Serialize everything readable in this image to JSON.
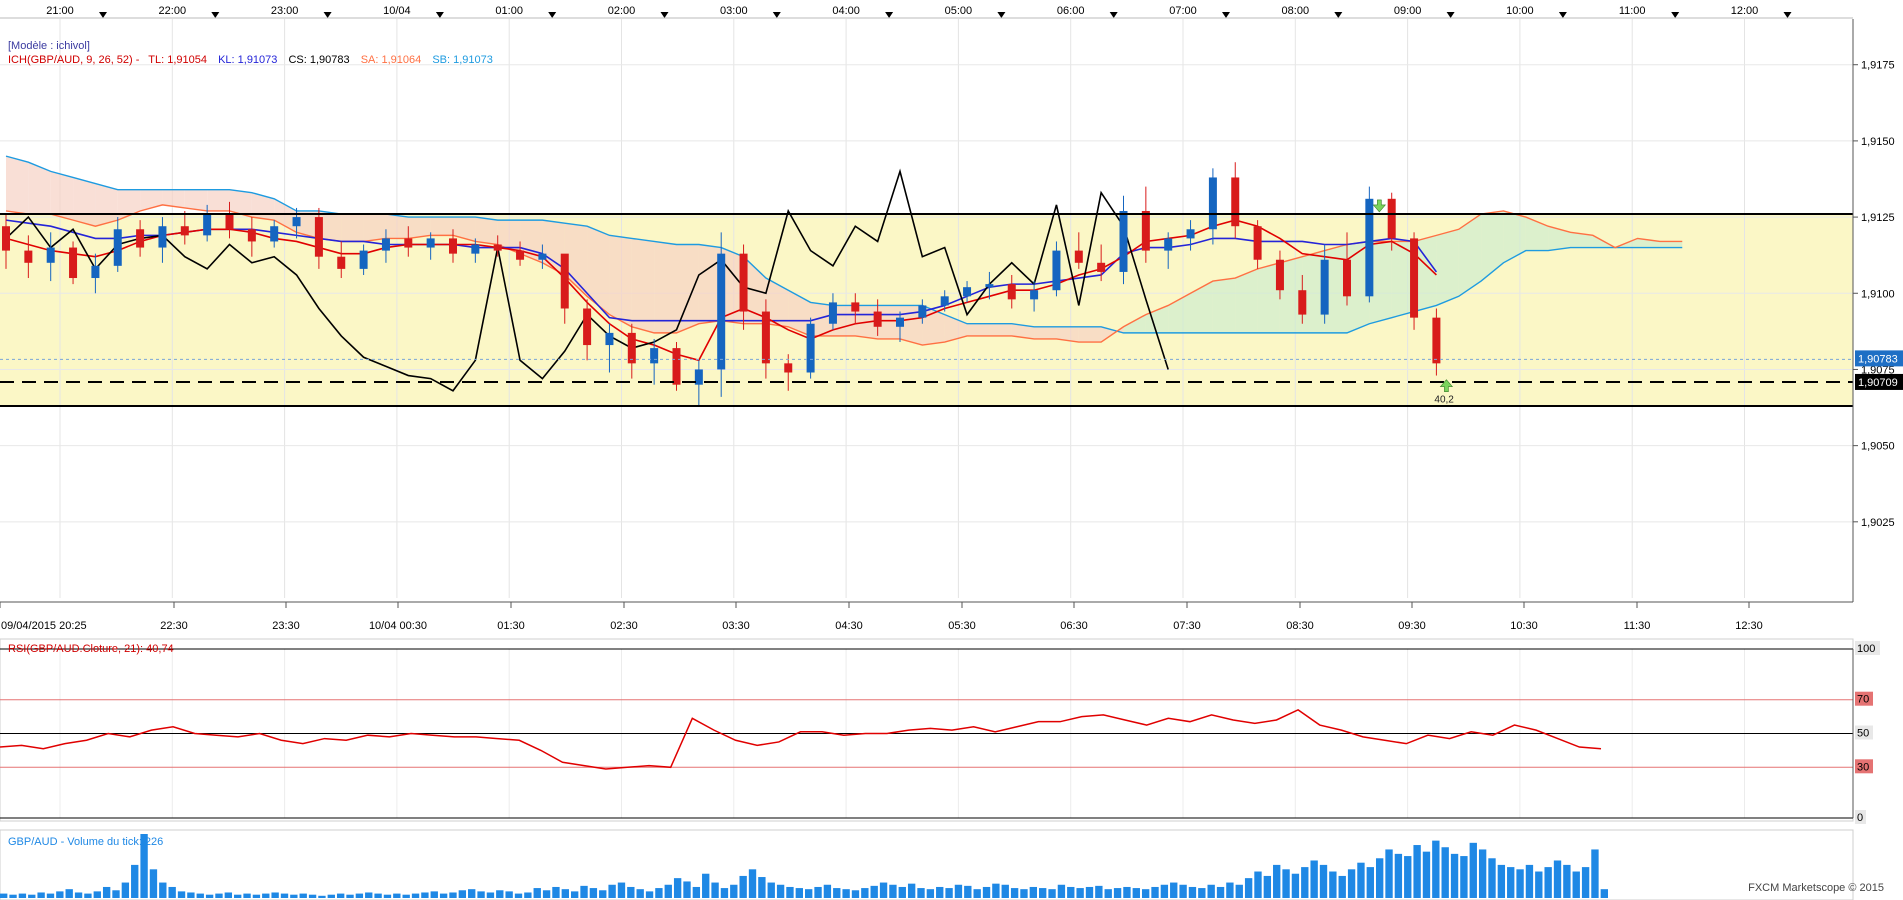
{
  "colors": {
    "bullish": "#1565c0",
    "bearish": "#d81b1b",
    "tenkan": "#e00000",
    "kijun": "#2424d8",
    "chikou": "#000000",
    "senkou_a": "#ff7043",
    "senkou_b": "#1e9be0",
    "band": "#fbf7c6",
    "rsi": "#e00000",
    "volume": "#1e88e5"
  },
  "top_time_axis": [
    "21:00",
    "22:00",
    "23:00",
    "10/04",
    "01:00",
    "02:00",
    "03:00",
    "04:00",
    "05:00",
    "06:00",
    "07:00",
    "08:00",
    "09:00",
    "10:00",
    "11:00",
    "12:00"
  ],
  "bottom_time_axis": [
    "09/04/2015 20:25",
    "22:30",
    "23:30",
    "10/04 00:30",
    "01:30",
    "02:30",
    "03:30",
    "04:30",
    "05:30",
    "06:30",
    "07:30",
    "08:30",
    "09:30",
    "10:30",
    "11:30",
    "12:30"
  ],
  "price_axis": [
    "1,9175",
    "1,9150",
    "1,9125",
    "1,9100",
    "1,9075",
    "1,9050",
    "1,9025"
  ],
  "price_badges": {
    "last": "1,90783",
    "marker": "1,90709"
  },
  "legend": {
    "model": "[Modèle : ichivol]",
    "ich": "ICH(GBP/AUD, 9, 26, 52) -",
    "tl": "TL: 1,91054",
    "kl": "KL: 1,91073",
    "cs": "CS: 1,90783",
    "sa": "SA: 1,91064",
    "sb": "SB: 1,91073"
  },
  "annotation": "40,2",
  "rsi": {
    "title": "RSI(GBP/AUD.Cloture, 21): 40,74",
    "levels": [
      "100",
      "70",
      "50",
      "30",
      "0"
    ]
  },
  "volume_panel": {
    "title": "GBP/AUD - Volume du tick: 226"
  },
  "watermark": "FXCM Marketscope © 2015",
  "chart_data": [
    {
      "type": "candlestick",
      "title": "ICH(GBP/AUD, 9, 26, 52)",
      "ylim": [
        1.9,
        1.919
      ],
      "zones": {
        "upper": 1.9126,
        "lower": 1.9063,
        "dashed": 1.90709
      },
      "candles": [
        [
          1.9122,
          1.9126,
          1.9108,
          1.9114
        ],
        [
          1.9114,
          1.9119,
          1.9105,
          1.911
        ],
        [
          1.911,
          1.912,
          1.9104,
          1.9115
        ],
        [
          1.9115,
          1.9117,
          1.9103,
          1.9105
        ],
        [
          1.9105,
          1.9113,
          1.91,
          1.9109
        ],
        [
          1.9109,
          1.9125,
          1.9107,
          1.9121
        ],
        [
          1.9121,
          1.9124,
          1.9112,
          1.9115
        ],
        [
          1.9115,
          1.9125,
          1.911,
          1.9122
        ],
        [
          1.9122,
          1.9127,
          1.9116,
          1.9119
        ],
        [
          1.9119,
          1.9129,
          1.9117,
          1.9126
        ],
        [
          1.9126,
          1.913,
          1.9118,
          1.9121
        ],
        [
          1.9121,
          1.9125,
          1.9112,
          1.9117
        ],
        [
          1.9117,
          1.9124,
          1.9115,
          1.9122
        ],
        [
          1.9122,
          1.9128,
          1.9118,
          1.9125
        ],
        [
          1.9125,
          1.9128,
          1.9108,
          1.9112
        ],
        [
          1.9112,
          1.9117,
          1.9105,
          1.9108
        ],
        [
          1.9108,
          1.9116,
          1.9106,
          1.9114
        ],
        [
          1.9114,
          1.9121,
          1.911,
          1.9118
        ],
        [
          1.9118,
          1.9122,
          1.9112,
          1.9115
        ],
        [
          1.9115,
          1.912,
          1.9111,
          1.9118
        ],
        [
          1.9118,
          1.9121,
          1.911,
          1.9113
        ],
        [
          1.9113,
          1.9118,
          1.911,
          1.9116
        ],
        [
          1.9116,
          1.9119,
          1.9112,
          1.9114
        ],
        [
          1.9114,
          1.9117,
          1.9109,
          1.9111
        ],
        [
          1.9111,
          1.9116,
          1.9108,
          1.9113
        ],
        [
          1.9113,
          1.911,
          1.909,
          1.9095
        ],
        [
          1.9095,
          1.9098,
          1.9078,
          1.9083
        ],
        [
          1.9083,
          1.909,
          1.9074,
          1.9087
        ],
        [
          1.9087,
          1.909,
          1.9072,
          1.9077
        ],
        [
          1.9077,
          1.9085,
          1.907,
          1.9082
        ],
        [
          1.9082,
          1.9084,
          1.9068,
          1.907
        ],
        [
          1.907,
          1.9078,
          1.9063,
          1.9075
        ],
        [
          1.9075,
          1.912,
          1.9066,
          1.9113
        ],
        [
          1.9113,
          1.9116,
          1.9088,
          1.9094
        ],
        [
          1.9094,
          1.9098,
          1.9072,
          1.9077
        ],
        [
          1.9077,
          1.908,
          1.9068,
          1.9074
        ],
        [
          1.9074,
          1.9092,
          1.9072,
          1.909
        ],
        [
          1.909,
          1.91,
          1.9088,
          1.9097
        ],
        [
          1.9097,
          1.91,
          1.909,
          1.9094
        ],
        [
          1.9094,
          1.9098,
          1.9086,
          1.9089
        ],
        [
          1.9089,
          1.9094,
          1.9084,
          1.9092
        ],
        [
          1.9092,
          1.9098,
          1.909,
          1.9096
        ],
        [
          1.9096,
          1.9101,
          1.9094,
          1.9099
        ],
        [
          1.9099,
          1.9104,
          1.9097,
          1.9102
        ],
        [
          1.9102,
          1.9107,
          1.9098,
          1.9103
        ],
        [
          1.9103,
          1.9106,
          1.9095,
          1.9098
        ],
        [
          1.9098,
          1.9104,
          1.9094,
          1.9101
        ],
        [
          1.9101,
          1.9117,
          1.9099,
          1.9114
        ],
        [
          1.9114,
          1.912,
          1.9108,
          1.911
        ],
        [
          1.911,
          1.9116,
          1.9104,
          1.9107
        ],
        [
          1.9107,
          1.9132,
          1.9103,
          1.9127
        ],
        [
          1.9127,
          1.9135,
          1.911,
          1.9114
        ],
        [
          1.9114,
          1.912,
          1.9108,
          1.9118
        ],
        [
          1.9118,
          1.9124,
          1.9114,
          1.9121
        ],
        [
          1.9121,
          1.9141,
          1.9116,
          1.9138
        ],
        [
          1.9138,
          1.9143,
          1.9118,
          1.9122
        ],
        [
          1.9122,
          1.9124,
          1.9108,
          1.9111
        ],
        [
          1.9111,
          1.9114,
          1.9098,
          1.9101
        ],
        [
          1.9101,
          1.9106,
          1.909,
          1.9093
        ],
        [
          1.9093,
          1.9116,
          1.909,
          1.9111
        ],
        [
          1.9111,
          1.912,
          1.9096,
          1.9099
        ],
        [
          1.9099,
          1.9135,
          1.9097,
          1.9131
        ],
        [
          1.9131,
          1.9133,
          1.9114,
          1.9118
        ],
        [
          1.9118,
          1.912,
          1.9088,
          1.9092
        ],
        [
          1.9092,
          1.9095,
          1.9073,
          1.9077
        ]
      ],
      "tenkan": [
        1.9118,
        1.9116,
        1.9114,
        1.9113,
        1.9112,
        1.9114,
        1.9117,
        1.9119,
        1.912,
        1.9121,
        1.9121,
        1.912,
        1.9118,
        1.9117,
        1.9115,
        1.9113,
        1.9113,
        1.9115,
        1.9116,
        1.9116,
        1.9116,
        1.9116,
        1.9115,
        1.9114,
        1.9112,
        1.9105,
        1.9097,
        1.909,
        1.9085,
        1.9083,
        1.908,
        1.9078,
        1.9092,
        1.9095,
        1.9092,
        1.9088,
        1.9085,
        1.9088,
        1.909,
        1.9091,
        1.9091,
        1.9092,
        1.9095,
        1.9097,
        1.9099,
        1.9101,
        1.9101,
        1.9103,
        1.9106,
        1.9108,
        1.9112,
        1.9117,
        1.9118,
        1.9119,
        1.9122,
        1.9124,
        1.9122,
        1.9118,
        1.9113,
        1.9112,
        1.9111,
        1.9116,
        1.9117,
        1.9113,
        1.9106
      ],
      "kijun": [
        1.9124,
        1.9123,
        1.9122,
        1.912,
        1.9118,
        1.9118,
        1.9119,
        1.9119,
        1.912,
        1.9121,
        1.9121,
        1.9121,
        1.912,
        1.9119,
        1.9118,
        1.9117,
        1.9117,
        1.9116,
        1.9116,
        1.9116,
        1.9116,
        1.9115,
        1.9115,
        1.9115,
        1.9113,
        1.9108,
        1.91,
        1.9092,
        1.9091,
        1.9091,
        1.9091,
        1.9091,
        1.9091,
        1.9091,
        1.9091,
        1.9091,
        1.9091,
        1.9093,
        1.9093,
        1.9093,
        1.9093,
        1.9094,
        1.9096,
        1.9099,
        1.9102,
        1.9103,
        1.9103,
        1.9104,
        1.9105,
        1.9106,
        1.9113,
        1.9115,
        1.9115,
        1.9116,
        1.9118,
        1.9118,
        1.9117,
        1.9117,
        1.9117,
        1.9116,
        1.9116,
        1.9117,
        1.9118,
        1.9117,
        1.9107
      ],
      "chikou": [
        1.9118,
        1.9125,
        1.9115,
        1.9121,
        1.9108,
        1.9116,
        1.9118,
        1.9119,
        1.9112,
        1.9108,
        1.9116,
        1.911,
        1.9112,
        1.9106,
        1.9095,
        1.9086,
        1.9079,
        1.9076,
        1.9073,
        1.9072,
        1.9068,
        1.9078,
        1.9115,
        1.9078,
        1.9072,
        1.9081,
        1.9093,
        1.9086,
        1.9082,
        1.9084,
        1.9088,
        1.9106,
        1.9111,
        1.9102,
        1.91,
        1.9127,
        1.9114,
        1.9109,
        1.9122,
        1.9117,
        1.914,
        1.9112,
        1.9115,
        1.9093,
        1.9103,
        1.911,
        1.9103,
        1.9129,
        1.9096,
        1.9133,
        1.9122,
        1.9098,
        1.9075
      ],
      "senkou_a": [
        1.9127,
        1.9126,
        1.9126,
        1.9124,
        1.9122,
        1.9124,
        1.9127,
        1.9129,
        1.9128,
        1.9127,
        1.9127,
        1.9125,
        1.9124,
        1.912,
        1.9118,
        1.9117,
        1.9117,
        1.9118,
        1.9118,
        1.9119,
        1.9119,
        1.9117,
        1.9116,
        1.9113,
        1.911,
        1.9106,
        1.9099,
        1.9093,
        1.9089,
        1.9087,
        1.9087,
        1.909,
        1.9091,
        1.909,
        1.909,
        1.9089,
        1.9086,
        1.9086,
        1.9086,
        1.9085,
        1.9085,
        1.9083,
        1.9084,
        1.9086,
        1.9086,
        1.9086,
        1.9085,
        1.9085,
        1.9084,
        1.9084,
        1.9089,
        1.9093,
        1.9096,
        1.91,
        1.9104,
        1.9105,
        1.9108,
        1.911,
        1.9112,
        1.9114,
        1.9116,
        1.9117,
        1.9117,
        1.9117,
        1.9119,
        1.9121,
        1.9126,
        1.9127,
        1.9125,
        1.9122,
        1.912,
        1.9119,
        1.9115,
        1.9118,
        1.9117,
        1.9117
      ],
      "senkou_b": [
        1.9145,
        1.9143,
        1.914,
        1.9138,
        1.9136,
        1.9134,
        1.9134,
        1.9134,
        1.9134,
        1.9134,
        1.9134,
        1.9133,
        1.9131,
        1.9127,
        1.9127,
        1.9126,
        1.9126,
        1.9126,
        1.9125,
        1.9125,
        1.9125,
        1.9125,
        1.9124,
        1.9124,
        1.9124,
        1.9123,
        1.9122,
        1.9119,
        1.9118,
        1.9117,
        1.9116,
        1.9116,
        1.9115,
        1.9112,
        1.9105,
        1.9101,
        1.9097,
        1.9096,
        1.9096,
        1.9096,
        1.9096,
        1.9096,
        1.9093,
        1.909,
        1.909,
        1.909,
        1.9089,
        1.9089,
        1.9089,
        1.9089,
        1.9087,
        1.9087,
        1.9087,
        1.9087,
        1.9087,
        1.9087,
        1.9087,
        1.9087,
        1.9087,
        1.9087,
        1.9087,
        1.909,
        1.9092,
        1.9094,
        1.9096,
        1.9099,
        1.9104,
        1.911,
        1.9114,
        1.9114,
        1.9115,
        1.9115,
        1.9115,
        1.9115,
        1.9115,
        1.9115
      ]
    },
    {
      "type": "line",
      "title": "RSI(GBP/AUD.Cloture, 21): 40,74",
      "ylim": [
        0,
        100
      ],
      "levels": [
        100,
        70,
        50,
        30,
        0
      ],
      "values": [
        42,
        43,
        41,
        44,
        46,
        50,
        48,
        52,
        54,
        50,
        49,
        48,
        50,
        46,
        44,
        47,
        46,
        49,
        48,
        50,
        49,
        48,
        48,
        47,
        46,
        40,
        33,
        31,
        29,
        30,
        31,
        30,
        59,
        52,
        46,
        43,
        45,
        51,
        51,
        49,
        50,
        50,
        52,
        53,
        52,
        54,
        51,
        54,
        57,
        57,
        60,
        61,
        58,
        55,
        59,
        57,
        61,
        58,
        56,
        58,
        64,
        55,
        52,
        48,
        46,
        44,
        49,
        47,
        51,
        49,
        55,
        52,
        47,
        42,
        41
      ]
    },
    {
      "type": "bar",
      "title": "GBP/AUD - Volume du tick: 226",
      "values": [
        4,
        3,
        4,
        3,
        5,
        4,
        6,
        8,
        5,
        4,
        6,
        10,
        7,
        14,
        30,
        58,
        26,
        14,
        10,
        6,
        5,
        4,
        3,
        4,
        5,
        3,
        4,
        3,
        4,
        5,
        4,
        3,
        4,
        3,
        2,
        3,
        4,
        3,
        4,
        5,
        4,
        3,
        4,
        3,
        4,
        5,
        6,
        4,
        5,
        7,
        8,
        6,
        5,
        7,
        6,
        4,
        5,
        9,
        7,
        10,
        8,
        6,
        11,
        9,
        7,
        12,
        14,
        10,
        8,
        6,
        9,
        12,
        18,
        15,
        10,
        22,
        14,
        9,
        12,
        20,
        26,
        19,
        14,
        12,
        10,
        9,
        8,
        10,
        12,
        9,
        8,
        7,
        9,
        11,
        14,
        12,
        10,
        13,
        9,
        8,
        10,
        9,
        12,
        11,
        8,
        10,
        13,
        12,
        9,
        8,
        10,
        9,
        8,
        12,
        10,
        9,
        10,
        11,
        8,
        9,
        10,
        9,
        8,
        10,
        12,
        14,
        12,
        10,
        9,
        12,
        10,
        14,
        12,
        18,
        24,
        20,
        30,
        26,
        22,
        28,
        34,
        30,
        24,
        20,
        26,
        32,
        28,
        36,
        44,
        40,
        38,
        48,
        42,
        52,
        46,
        40,
        38,
        50,
        44,
        36,
        30,
        28,
        26,
        30,
        24,
        28,
        34,
        30,
        24,
        28,
        44,
        8
      ]
    }
  ]
}
